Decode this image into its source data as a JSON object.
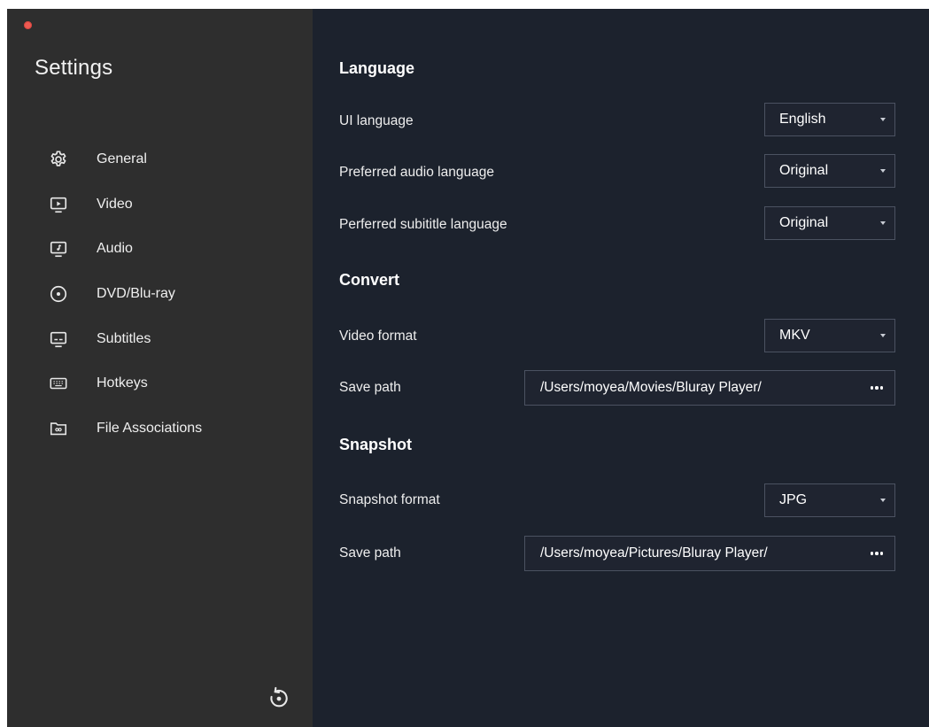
{
  "window": {
    "title": "Settings"
  },
  "sidebar": {
    "items": [
      {
        "label": "General",
        "icon": "gear-icon"
      },
      {
        "label": "Video",
        "icon": "video-icon"
      },
      {
        "label": "Audio",
        "icon": "audio-icon"
      },
      {
        "label": "DVD/Blu-ray",
        "icon": "disc-icon"
      },
      {
        "label": "Subtitles",
        "icon": "subtitles-icon"
      },
      {
        "label": "Hotkeys",
        "icon": "keyboard-icon"
      },
      {
        "label": "File Associations",
        "icon": "folder-icon"
      }
    ],
    "reset_icon": "reset-icon"
  },
  "language": {
    "title": "Language",
    "ui_language": {
      "label": "UI language",
      "value": "English"
    },
    "audio_language": {
      "label": "Preferred audio language",
      "value": "Original"
    },
    "subtitle_language": {
      "label": "Perferred subititle language",
      "value": "Original"
    }
  },
  "convert": {
    "title": "Convert",
    "video_format": {
      "label": "Video format",
      "value": "MKV"
    },
    "save_path": {
      "label": "Save path",
      "value": "/Users/moyea/Movies/Bluray Player/"
    }
  },
  "snapshot": {
    "title": "Snapshot",
    "snapshot_format": {
      "label": "Snapshot format",
      "value": "JPG"
    },
    "save_path": {
      "label": "Save path",
      "value": "/Users/moyea/Pictures/Bluray Player/"
    }
  },
  "colors": {
    "sidebar_bg": "#2e2e2e",
    "main_bg": "#1c222d",
    "close_button": "#ee5a52",
    "field_border": "#4b5261"
  }
}
